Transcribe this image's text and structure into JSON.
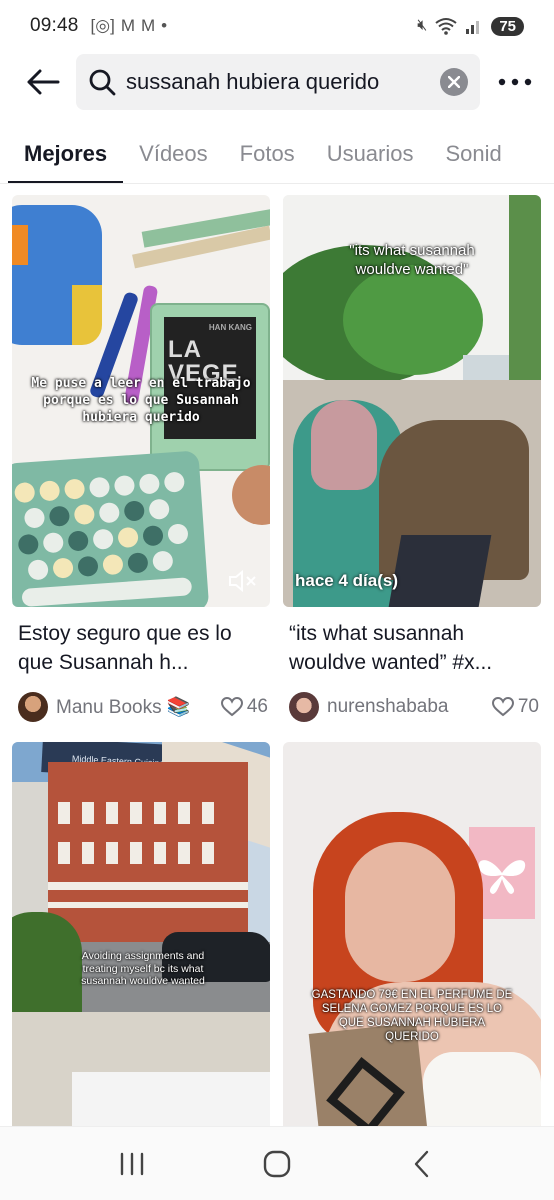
{
  "status_bar": {
    "time": "09:48",
    "battery": "75"
  },
  "search": {
    "query": "sussanah hubiera querido"
  },
  "tabs": [
    {
      "label": "Mejores",
      "active": true
    },
    {
      "label": "Vídeos"
    },
    {
      "label": "Fotos"
    },
    {
      "label": "Usuarios"
    },
    {
      "label": "Sonid"
    }
  ],
  "results": [
    {
      "overlay": "Me puse a leer en el trabajo porque es lo que Susannah hubiera querido",
      "book_title": "LA VEGE",
      "book_author": "HAN KANG",
      "title": "Estoy seguro que es lo que Susannah h...",
      "author": "Manu Books 📚",
      "likes": "46"
    },
    {
      "overlay": "\"its what susannah wouldve wanted\"",
      "time_ago": "hace 4 día(s)",
      "title": "“its what susannah wouldve wanted” #x...",
      "author": "nurenshababa",
      "likes": "70"
    },
    {
      "overlay": "Avoiding assignments and treating myself bc its what susannah wouldve wanted",
      "sign_text": "Middle Eastern Cuisine"
    },
    {
      "overlay": "GASTANDO 79€ EN EL PERFUME DE SELENA GOMEZ PORQUE ES LO QUE SUSANNAH HUBIERA QUERIDO"
    }
  ],
  "colors": {
    "accent": "#161823",
    "muted": "#8a8b91",
    "search_bg": "#f1f1f2"
  }
}
